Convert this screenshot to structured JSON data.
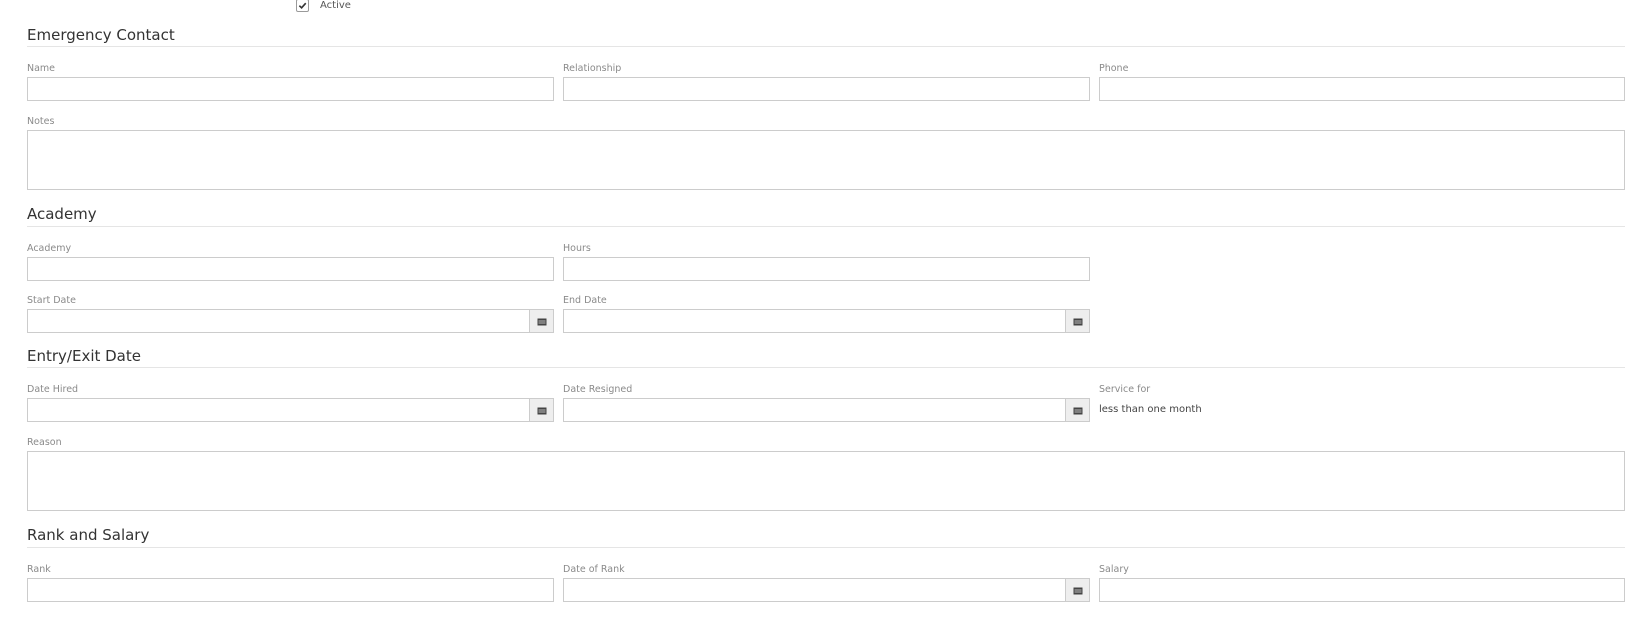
{
  "active": {
    "label": "Active",
    "checked": true
  },
  "emergency_contact": {
    "title": "Emergency Contact",
    "name_label": "Name",
    "name_value": "",
    "relationship_label": "Relationship",
    "relationship_value": "",
    "phone_label": "Phone",
    "phone_value": "",
    "notes_label": "Notes",
    "notes_value": ""
  },
  "academy": {
    "title": "Academy",
    "academy_label": "Academy",
    "academy_value": "",
    "hours_label": "Hours",
    "hours_value": "",
    "start_date_label": "Start Date",
    "start_date_value": "",
    "end_date_label": "End Date",
    "end_date_value": ""
  },
  "entry_exit": {
    "title": "Entry/Exit Date",
    "date_hired_label": "Date Hired",
    "date_hired_value": "",
    "date_resigned_label": "Date Resigned",
    "date_resigned_value": "",
    "service_for_label": "Service for",
    "service_for_value": "less than one month",
    "reason_label": "Reason",
    "reason_value": ""
  },
  "rank_salary": {
    "title": "Rank and Salary",
    "rank_label": "Rank",
    "rank_value": "",
    "date_of_rank_label": "Date of Rank",
    "date_of_rank_value": "",
    "salary_label": "Salary",
    "salary_value": ""
  },
  "icons": {
    "calendar": "calendar-icon",
    "check": "check-icon"
  }
}
